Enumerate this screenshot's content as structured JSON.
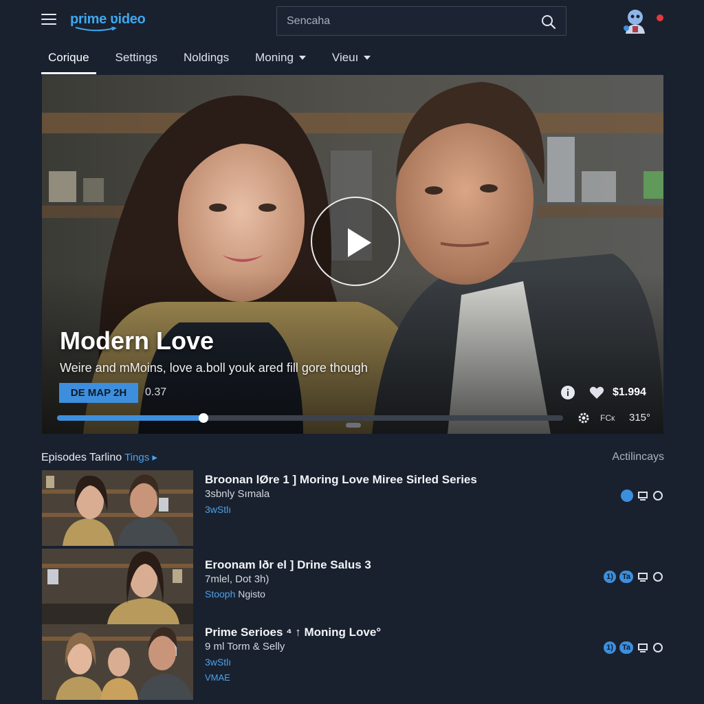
{
  "brand": {
    "logo_text": "prime ʋideo"
  },
  "search": {
    "placeholder": "Sencaha"
  },
  "nav": {
    "tabs": [
      {
        "label": "Corique",
        "active": true
      },
      {
        "label": "Settings"
      },
      {
        "label": "Noldings"
      },
      {
        "label": "Moning",
        "dropdown": true
      },
      {
        "label": "Vieuı",
        "dropdown": true
      }
    ]
  },
  "hero": {
    "title": "Modern Love",
    "description": "Weire and mMoins, love a.boll youk ared fill gore though",
    "badge": "DE MAP 2H",
    "time": "0.37",
    "price": "$1.994",
    "progress": 0.29,
    "quality": "FCк",
    "volume": "315°"
  },
  "episodes": {
    "header": "Episodes Tarlino",
    "header_link": "Tings",
    "side_link": "Actilincays",
    "items": [
      {
        "title": "Broonan lØre 1 ]  Moring Love Miree Sirled Series",
        "meta": "3sbnly Sımala",
        "tag": "3wStlı",
        "tag_plain": "",
        "extra": "",
        "pills": []
      },
      {
        "title": "Eroonam lðr el ] Drine Salus 3",
        "meta": "7mlel, Dot 3h)",
        "tag": "Stooph",
        "tag_plain": "Ngisto",
        "extra": "",
        "pills": [
          "1)",
          "Ta"
        ]
      },
      {
        "title": "Prime Serioes ⁴ ↑ Moning Love°",
        "meta": "9 ml Torm & Selly",
        "tag": "3wStlı",
        "tag_plain": "",
        "extra": "VMAE",
        "pills": [
          "1)",
          "Ta"
        ]
      }
    ]
  },
  "colors": {
    "accent": "#3d8fdd",
    "background": "#19212f",
    "notification": "#e23b3b"
  }
}
